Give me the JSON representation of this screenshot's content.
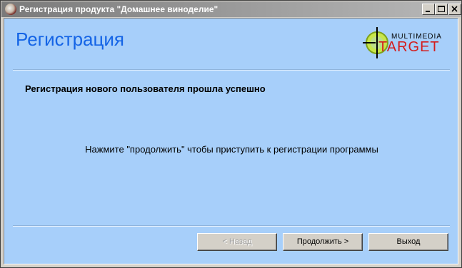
{
  "window": {
    "title": "Регистрация продукта \"Домашнее виноделие\"",
    "controls": {
      "minimize": "minimize",
      "maximize": "maximize",
      "close": "close"
    }
  },
  "header": {
    "title": "Регистрация",
    "logo": {
      "text_top": "MULTIMEDIA",
      "text_main": "TARGET",
      "icon": "crosshair-target-logo"
    }
  },
  "content": {
    "status_message": "Регистрация нового пользователя прошла успешно",
    "instruction": "Нажмите \"продолжить\" чтобы приступить к регистрации программы"
  },
  "buttons": {
    "back": {
      "label": "< Назад",
      "enabled": false
    },
    "continue": {
      "label": "Продолжить >",
      "enabled": true
    },
    "exit": {
      "label": "Выход",
      "enabled": true
    }
  },
  "colors": {
    "client_background": "#a7cffa",
    "heading": "#1464e6",
    "logo_red": "#d41c1c",
    "logo_green": "#9acd32"
  }
}
